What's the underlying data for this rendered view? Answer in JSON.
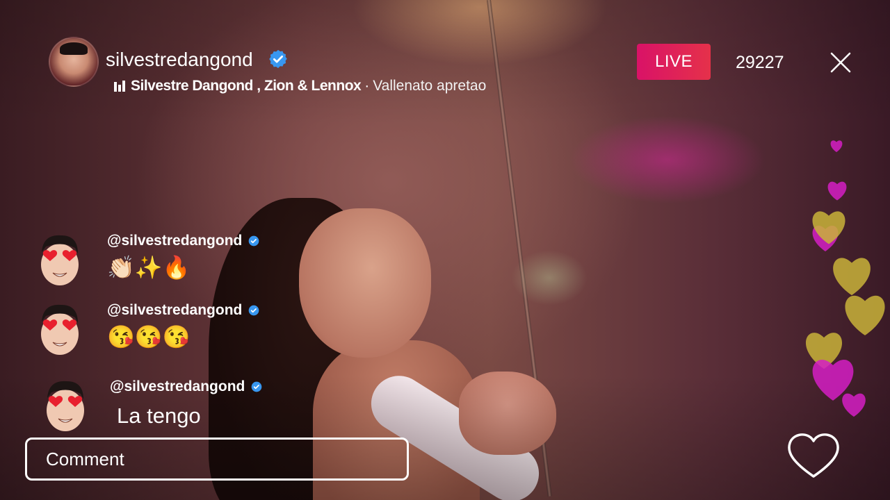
{
  "header": {
    "host_username": "silvestredangond",
    "host_verified": true,
    "music": {
      "icon": "equalizer-icon",
      "artists": "Silvestre Dangond , Zion & Lennox",
      "separator": "·",
      "song_title": "Vallenato apretao"
    },
    "live_label": "LIVE",
    "viewer_count": "29227",
    "close_icon": "close-icon"
  },
  "comments": [
    {
      "username": "@silvestredangond",
      "verified": true,
      "text": "👏🏻✨🔥",
      "avatar_icon": "heart-eyes-memoji-avatar"
    },
    {
      "username": "@silvestredangond",
      "verified": true,
      "text": "😘😘😘",
      "avatar_icon": "heart-eyes-memoji-avatar"
    },
    {
      "username": "@silvestredangond",
      "verified": true,
      "text": "La tengo",
      "avatar_icon": "heart-eyes-memoji-avatar"
    }
  ],
  "comment_input": {
    "placeholder": "Comment",
    "value": ""
  },
  "like_button": {
    "icon": "heart-outline-icon"
  },
  "colors": {
    "live_badge_start": "#d91267",
    "live_badge_end": "#e5314a",
    "verified_blue": "#3897f0",
    "heart_magenta": "#d51fc4",
    "heart_gold": "#c9b33a",
    "text": "#ffffff"
  }
}
